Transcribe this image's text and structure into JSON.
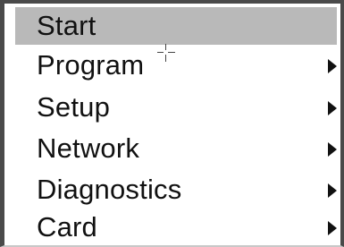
{
  "menu": {
    "items": [
      {
        "label": "Start",
        "selected": true,
        "has_submenu": false
      },
      {
        "label": "Program",
        "selected": false,
        "has_submenu": true
      },
      {
        "label": "Setup",
        "selected": false,
        "has_submenu": true
      },
      {
        "label": "Network",
        "selected": false,
        "has_submenu": true
      },
      {
        "label": "Diagnostics",
        "selected": false,
        "has_submenu": true
      },
      {
        "label": "Card",
        "selected": false,
        "has_submenu": true
      }
    ],
    "colors": {
      "selected_background": "#b9b9b9",
      "text": "#111111",
      "frame": "#4a4a4a",
      "background": "#ffffff"
    }
  }
}
